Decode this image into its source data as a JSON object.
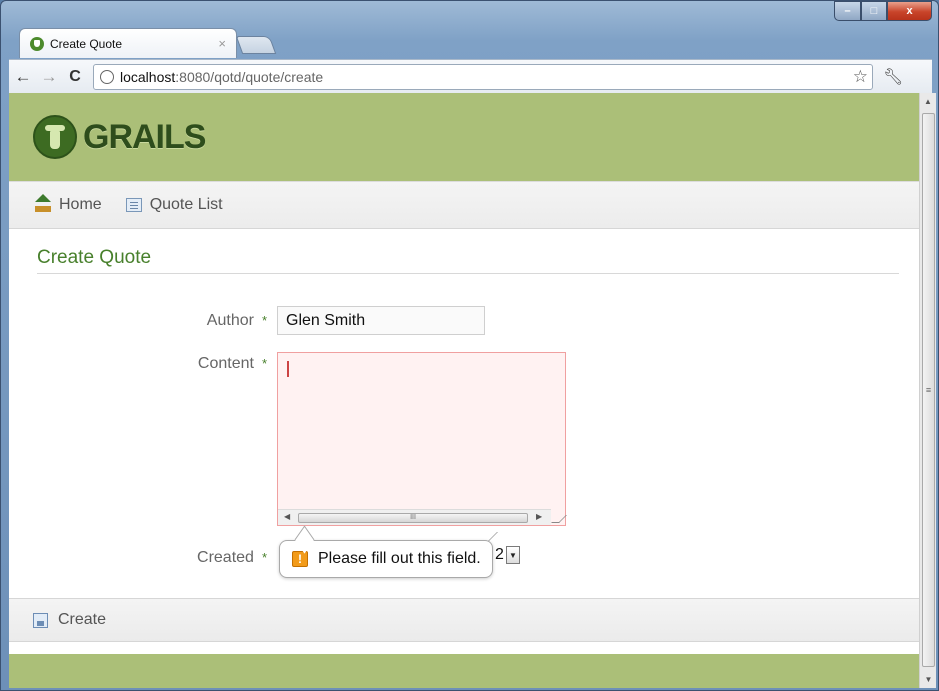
{
  "browser": {
    "tab_title": "Create Quote",
    "tab_close": "×",
    "window_controls": {
      "minimize": "–",
      "maximize": "□",
      "close": "x"
    },
    "nav": {
      "back": "←",
      "forward": "→",
      "reload": "C"
    },
    "url_host": "localhost",
    "url_path": ":8080/qotd/quote/create",
    "icons": [
      "globe-icon",
      "star-icon",
      "wrench-icon"
    ]
  },
  "header": {
    "logo_text": "GRAILS",
    "accent_color": "#abbf78"
  },
  "nav": {
    "items": [
      {
        "label": "Home",
        "icon": "home-icon"
      },
      {
        "label": "Quote List",
        "icon": "list-icon"
      }
    ]
  },
  "page": {
    "title": "Create Quote"
  },
  "form": {
    "author_label": "Author",
    "author_value": "Glen Smith",
    "content_label": "Content",
    "content_value": "",
    "created_label": "Created",
    "created_value": "2",
    "required_mark": "*",
    "validation_message": "Please fill out this field.",
    "warning_glyph": "!"
  },
  "buttons": {
    "create_label": "Create"
  }
}
